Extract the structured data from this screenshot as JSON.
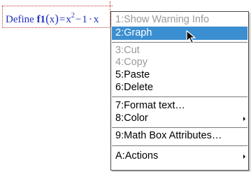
{
  "math_box": {
    "prefix": "Define",
    "func": "f1",
    "paren_open": "(",
    "var": "x",
    "paren_close": ")",
    "equals": "=",
    "base": "x",
    "exponent": "2",
    "minus": "−",
    "const": "1",
    "dot": "·",
    "tail": "x"
  },
  "menu": {
    "items": [
      {
        "label": "1:Show Warning Info",
        "state": "disabled"
      },
      {
        "label": "2:Graph",
        "state": "selected"
      },
      {
        "label": "3:Cut",
        "state": "disabled"
      },
      {
        "label": "4:Copy",
        "state": "disabled"
      },
      {
        "label": "5:Paste",
        "state": "enabled"
      },
      {
        "label": "6:Delete",
        "state": "enabled"
      },
      {
        "label": "7:Format text…",
        "state": "enabled"
      },
      {
        "label": "8:Color",
        "state": "enabled",
        "submenu": true
      },
      {
        "label": "9:Math Box Attributes…",
        "state": "enabled"
      },
      {
        "label": "A:Actions",
        "state": "enabled",
        "submenu": true
      }
    ]
  },
  "colors": {
    "math_text": "#1f2fbf",
    "selection": "#3b8ed0",
    "disabled_text": "#9a9a9a",
    "dotted_border": "#c0392b"
  }
}
